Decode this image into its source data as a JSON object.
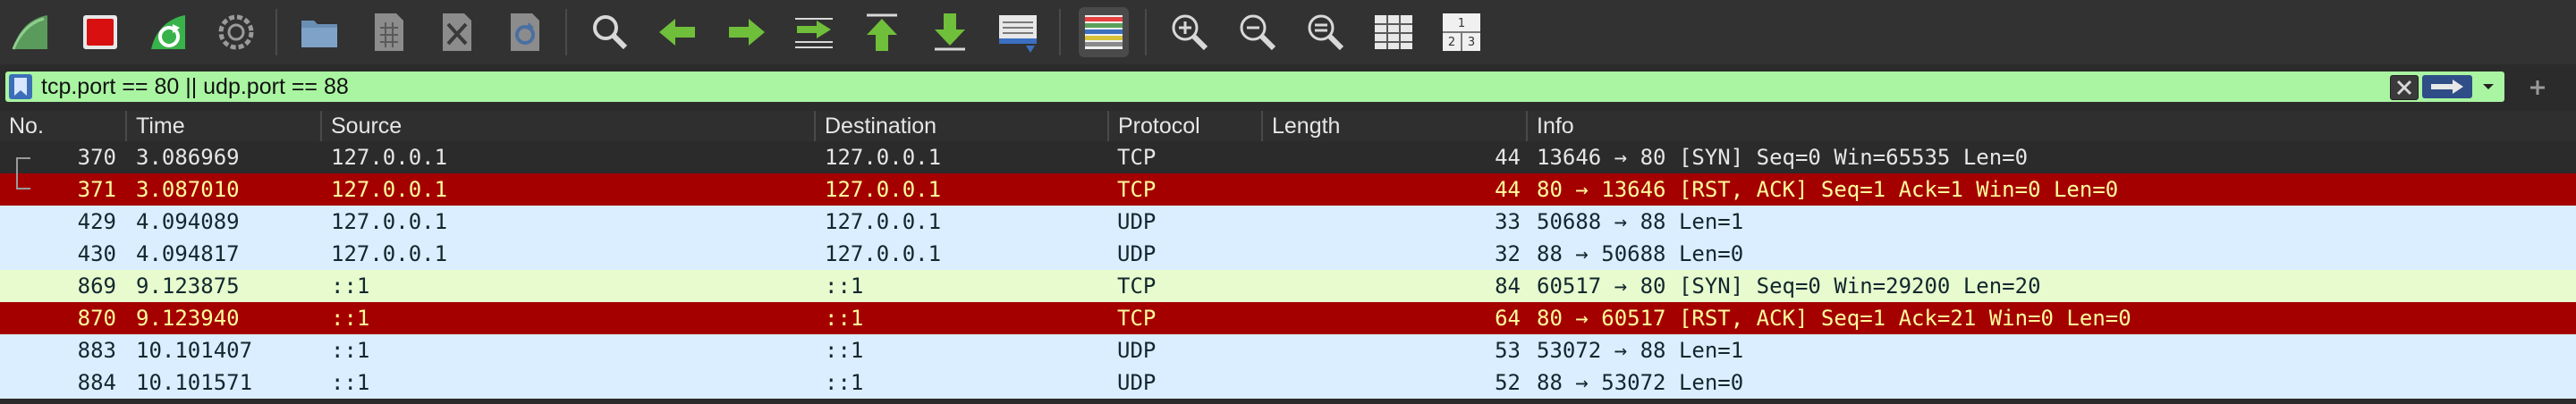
{
  "toolbar": {
    "buttons": [
      {
        "name": "start-capture-icon"
      },
      {
        "name": "stop-capture-icon"
      },
      {
        "name": "restart-capture-icon"
      },
      {
        "name": "capture-options-icon"
      },
      {
        "name": "open-file-icon"
      },
      {
        "name": "save-file-icon"
      },
      {
        "name": "close-file-icon"
      },
      {
        "name": "reload-file-icon"
      },
      {
        "name": "find-packet-icon"
      },
      {
        "name": "go-back-icon"
      },
      {
        "name": "go-forward-icon"
      },
      {
        "name": "go-to-packet-icon"
      },
      {
        "name": "go-first-packet-icon"
      },
      {
        "name": "go-last-packet-icon"
      },
      {
        "name": "auto-scroll-icon"
      },
      {
        "name": "colorize-icon"
      },
      {
        "name": "zoom-in-icon"
      },
      {
        "name": "zoom-out-icon"
      },
      {
        "name": "normal-size-icon"
      },
      {
        "name": "resize-columns-icon"
      },
      {
        "name": "layout-icon"
      }
    ]
  },
  "filter": {
    "value": "tcp.port == 80 || udp.port == 88",
    "color": "#a9f5a1"
  },
  "columns": [
    "No.",
    "Time",
    "Source",
    "Destination",
    "Protocol",
    "Length",
    "Info"
  ],
  "colors": {
    "tcp_normal_bg": "#2b2b2b",
    "tcp_rst_bg": "#a40000",
    "tcp_rst_fg": "#fffc9c",
    "udp_bg": "#daeeff",
    "tcp_v6_bg": "#e7fbce",
    "dark_fg": "#e6e6e6",
    "light_fg": "#12272e"
  },
  "packets": [
    {
      "no": "370",
      "time": "3.086969",
      "source": "127.0.0.1",
      "destination": "127.0.0.1",
      "protocol": "TCP",
      "length": "44",
      "info": "13646 → 80 [SYN] Seq=0 Win=65535 Len=0",
      "style": "tcp_normal",
      "related": "top"
    },
    {
      "no": "371",
      "time": "3.087010",
      "source": "127.0.0.1",
      "destination": "127.0.0.1",
      "protocol": "TCP",
      "length": "44",
      "info": "80 → 13646 [RST, ACK] Seq=1 Ack=1 Win=0 Len=0",
      "style": "tcp_rst",
      "related": "bottom"
    },
    {
      "no": "429",
      "time": "4.094089",
      "source": "127.0.0.1",
      "destination": "127.0.0.1",
      "protocol": "UDP",
      "length": "33",
      "info": "50688 → 88 Len=1",
      "style": "udp"
    },
    {
      "no": "430",
      "time": "4.094817",
      "source": "127.0.0.1",
      "destination": "127.0.0.1",
      "protocol": "UDP",
      "length": "32",
      "info": "88 → 50688 Len=0",
      "style": "udp"
    },
    {
      "no": "869",
      "time": "9.123875",
      "source": "::1",
      "destination": "::1",
      "protocol": "TCP",
      "length": "84",
      "info": "60517 → 80 [SYN] Seq=0 Win=29200 Len=20",
      "style": "tcp_v6"
    },
    {
      "no": "870",
      "time": "9.123940",
      "source": "::1",
      "destination": "::1",
      "protocol": "TCP",
      "length": "64",
      "info": "80 → 60517 [RST, ACK] Seq=1 Ack=21 Win=0 Len=0",
      "style": "tcp_rst"
    },
    {
      "no": "883",
      "time": "10.101407",
      "source": "::1",
      "destination": "::1",
      "protocol": "UDP",
      "length": "53",
      "info": "53072 → 88 Len=1",
      "style": "udp"
    },
    {
      "no": "884",
      "time": "10.101571",
      "source": "::1",
      "destination": "::1",
      "protocol": "UDP",
      "length": "52",
      "info": "88 → 53072 Len=0",
      "style": "udp"
    }
  ]
}
